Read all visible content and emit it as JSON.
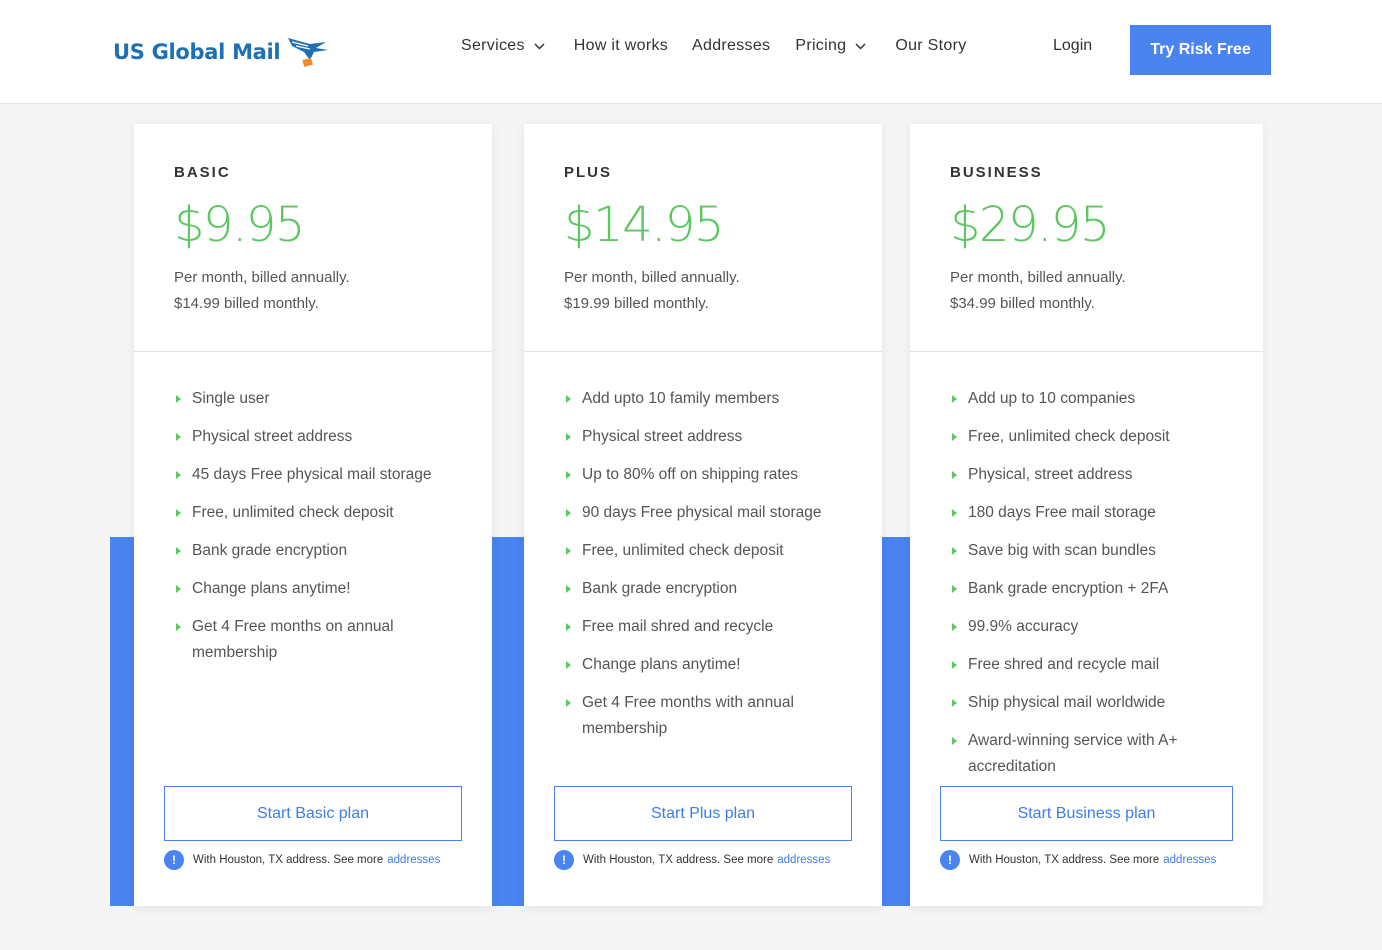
{
  "header": {
    "logo_text": "US Global Mail",
    "nav": [
      {
        "label": "Services",
        "has_dropdown": true
      },
      {
        "label": "How it works",
        "has_dropdown": false
      },
      {
        "label": "Addresses",
        "has_dropdown": false
      },
      {
        "label": "Pricing",
        "has_dropdown": true
      },
      {
        "label": "Our Story",
        "has_dropdown": false
      }
    ],
    "login": "Login",
    "cta": "Try Risk Free"
  },
  "colors": {
    "accent_blue": "#4a84f0",
    "price_green": "#5ac85e",
    "logo_blue": "#1f6fb3"
  },
  "plans": [
    {
      "name": "BASIC",
      "price": "$9.95",
      "billing_annual": "Per month, billed annually.",
      "billing_monthly": "$14.99 billed monthly.",
      "features": [
        "Single user",
        "Physical street address",
        "45 days Free physical mail storage",
        "Free, unlimited check deposit",
        "Bank grade encryption",
        "Change plans anytime!",
        "Get 4 Free months on annual membership"
      ],
      "button": "Start Basic plan",
      "note_text": "With Houston, TX address. See more",
      "note_link": "addresses"
    },
    {
      "name": "PLUS",
      "price": "$14.95",
      "billing_annual": "Per month, billed annually.",
      "billing_monthly": "$19.99 billed monthly.",
      "features": [
        "Add upto 10 family members",
        "Physical street address",
        "Up to 80% off on shipping rates",
        "90 days Free physical mail storage",
        "Free, unlimited check deposit",
        "Bank grade encryption",
        "Free mail shred and recycle",
        "Change plans anytime!",
        "Get 4 Free months with annual membership"
      ],
      "button": "Start Plus plan",
      "note_text": "With Houston, TX address. See more",
      "note_link": "addresses"
    },
    {
      "name": "BUSINESS",
      "price": "$29.95",
      "billing_annual": "Per month, billed annually.",
      "billing_monthly": "$34.99 billed monthly.",
      "features": [
        "Add up to 10 companies",
        "Free, unlimited check deposit",
        "Physical, street address",
        "180 days Free mail storage",
        "Save big with scan bundles",
        "Bank grade encryption + 2FA",
        "99.9% accuracy",
        "Free shred and recycle mail",
        "Ship physical mail worldwide",
        "Award-winning service with A+ accreditation"
      ],
      "button": "Start Business plan",
      "note_text": "With Houston, TX address. See more",
      "note_link": "addresses"
    }
  ]
}
